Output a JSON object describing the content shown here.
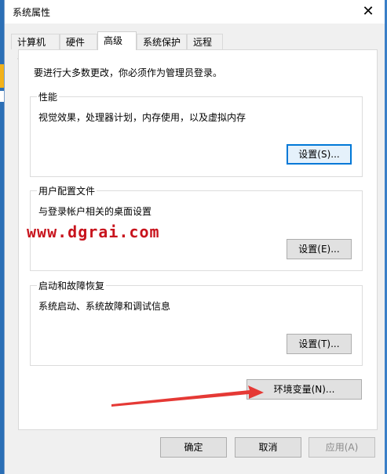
{
  "window": {
    "title": "系统属性",
    "close_glyph": "✕"
  },
  "tabs": [
    {
      "label": "计算机名"
    },
    {
      "label": "硬件"
    },
    {
      "label": "高级"
    },
    {
      "label": "系统保护"
    },
    {
      "label": "远程"
    }
  ],
  "panel": {
    "notice": "要进行大多数更改，你必须作为管理员登录。",
    "performance": {
      "title": "性能",
      "desc": "视觉效果，处理器计划，内存使用，以及虚拟内存",
      "button": "设置(S)..."
    },
    "profile": {
      "title": "用户配置文件",
      "desc": "与登录帐户相关的桌面设置",
      "button": "设置(E)..."
    },
    "startup": {
      "title": "启动和故障恢复",
      "desc": "系统启动、系统故障和调试信息",
      "button": "设置(T)..."
    },
    "env_button": "环境变量(N)..."
  },
  "footer": {
    "ok": "确定",
    "cancel": "取消",
    "apply": "应用(A)"
  },
  "watermark": "www.dgrai.com",
  "colors": {
    "accent": "#0078d7",
    "arrow": "#e53935",
    "watermark": "#c8141d"
  }
}
